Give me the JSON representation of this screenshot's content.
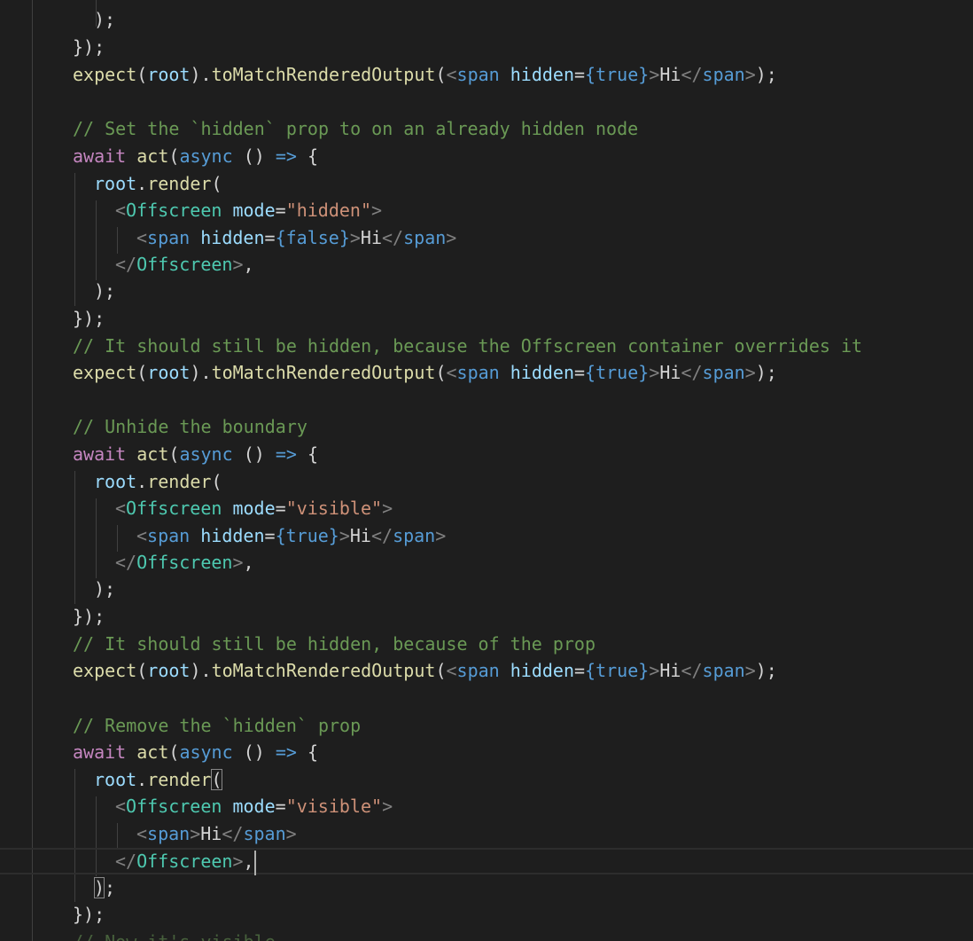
{
  "editor": {
    "language": "jsx",
    "theme": "dark",
    "current_line_index": 32,
    "cursor_after": ",",
    "colors": {
      "background": "#1e1e1e",
      "keyword": "#569cd6",
      "control": "#c586c0",
      "function": "#dcdcaa",
      "variable": "#9cdcfe",
      "string": "#ce9178",
      "component": "#4ec9b0",
      "comment": "#6a9955",
      "punctuation": "#d4d4d4",
      "bracket_tag": "#808080"
    }
  },
  "tokens": {
    "await": "await",
    "act": "act",
    "async": "async",
    "arrow_open": " () ",
    "arrow": "=>",
    "brace_open": " {",
    "root": "root",
    "dot": ".",
    "render": "render",
    "lparen": "(",
    "rparen": ")",
    "semicolon": ";",
    "close_call": ");",
    "close_block": "});",
    "expect": "expect",
    "to_match": "toMatchRenderedOutput",
    "lt": "<",
    "lt_slash": "</",
    "gt": ">",
    "gt_comma": ">,",
    "span": "span",
    "offscreen": "Offscreen",
    "hidden_attr": "hidden",
    "mode_attr": "mode",
    "eq": "=",
    "eq_brace": "={",
    "rbrace": "}",
    "true": "true",
    "false": "false",
    "str_hidden": "\"hidden\"",
    "str_visible": "\"visible\"",
    "hi": "Hi",
    "space": " ",
    "next_comment_partial": "// Now it's visible"
  },
  "comments": {
    "c1": "// Set the `hidden` prop to on an already hidden node",
    "c2": "// It should still be hidden, because the Offscreen container overrides it",
    "c3": "// Unhide the boundary",
    "c4": "// It should still be hidden, because of the prop",
    "c5": "// Remove the `hidden` prop"
  }
}
